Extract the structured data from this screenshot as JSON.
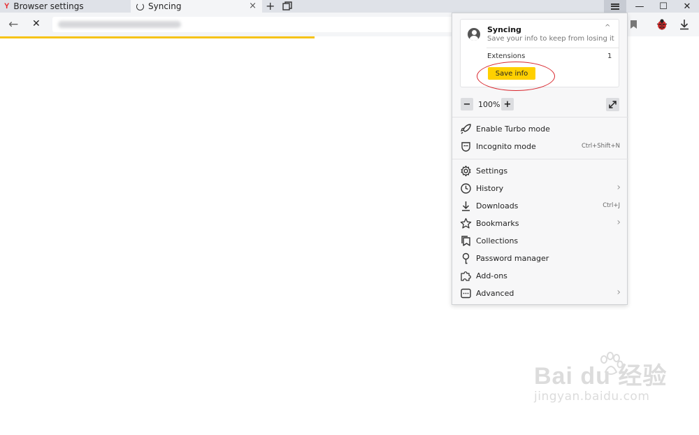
{
  "tabs": [
    {
      "title": "Browser settings",
      "logo": "Y"
    },
    {
      "title": "Syncing",
      "close": "×"
    }
  ],
  "tabbar": {
    "new_tab": "+",
    "tabs_manager_icon": "tabs-manager-icon"
  },
  "window": {
    "minimize": "—",
    "maximize": "☐",
    "close": "✕"
  },
  "nav": {
    "back": "←",
    "stop": "✕"
  },
  "address": {
    "url_blurred": true
  },
  "toolbar": {
    "bookmark_icon": "bookmark-icon",
    "extension_icon": "ladybug-icon",
    "downloads_icon": "download-icon"
  },
  "progress": {
    "value": 0.45,
    "color": "#f6c318"
  },
  "menu": {
    "sync": {
      "title": "Syncing",
      "subtitle": "Save your info to keep from losing it",
      "collapse": "^",
      "extensions_label": "Extensions",
      "extensions_count": "1",
      "save_button": "Save info"
    },
    "zoom": {
      "minus": "−",
      "value": "100%",
      "plus": "+"
    },
    "items_group1": [
      {
        "label": "Enable Turbo mode",
        "icon": "rocket-icon",
        "shortcut": ""
      },
      {
        "label": "Incognito mode",
        "icon": "incognito-mask-icon",
        "shortcut": "Ctrl+Shift+N"
      }
    ],
    "items_group2": [
      {
        "label": "Settings",
        "icon": "gear-icon",
        "shortcut": "",
        "submenu": false
      },
      {
        "label": "History",
        "icon": "clock-icon",
        "shortcut": "",
        "submenu": true
      },
      {
        "label": "Downloads",
        "icon": "download-icon",
        "shortcut": "Ctrl+J",
        "submenu": false
      },
      {
        "label": "Bookmarks",
        "icon": "star-icon",
        "shortcut": "",
        "submenu": true
      },
      {
        "label": "Collections",
        "icon": "collections-icon",
        "shortcut": "",
        "submenu": false
      },
      {
        "label": "Password manager",
        "icon": "key-icon",
        "shortcut": "",
        "submenu": false
      },
      {
        "label": "Add-ons",
        "icon": "puzzle-icon",
        "shortcut": "",
        "submenu": false
      },
      {
        "label": "Advanced",
        "icon": "more-icon",
        "shortcut": "",
        "submenu": true
      }
    ],
    "submenu_arrow": "›"
  },
  "watermark": {
    "main": "Bai du 经验",
    "sub": "jingyan.baidu.com"
  },
  "colors": {
    "accent_yellow": "#ffd000",
    "highlight_red": "#d9272e",
    "yandex_red": "#e8262b"
  }
}
